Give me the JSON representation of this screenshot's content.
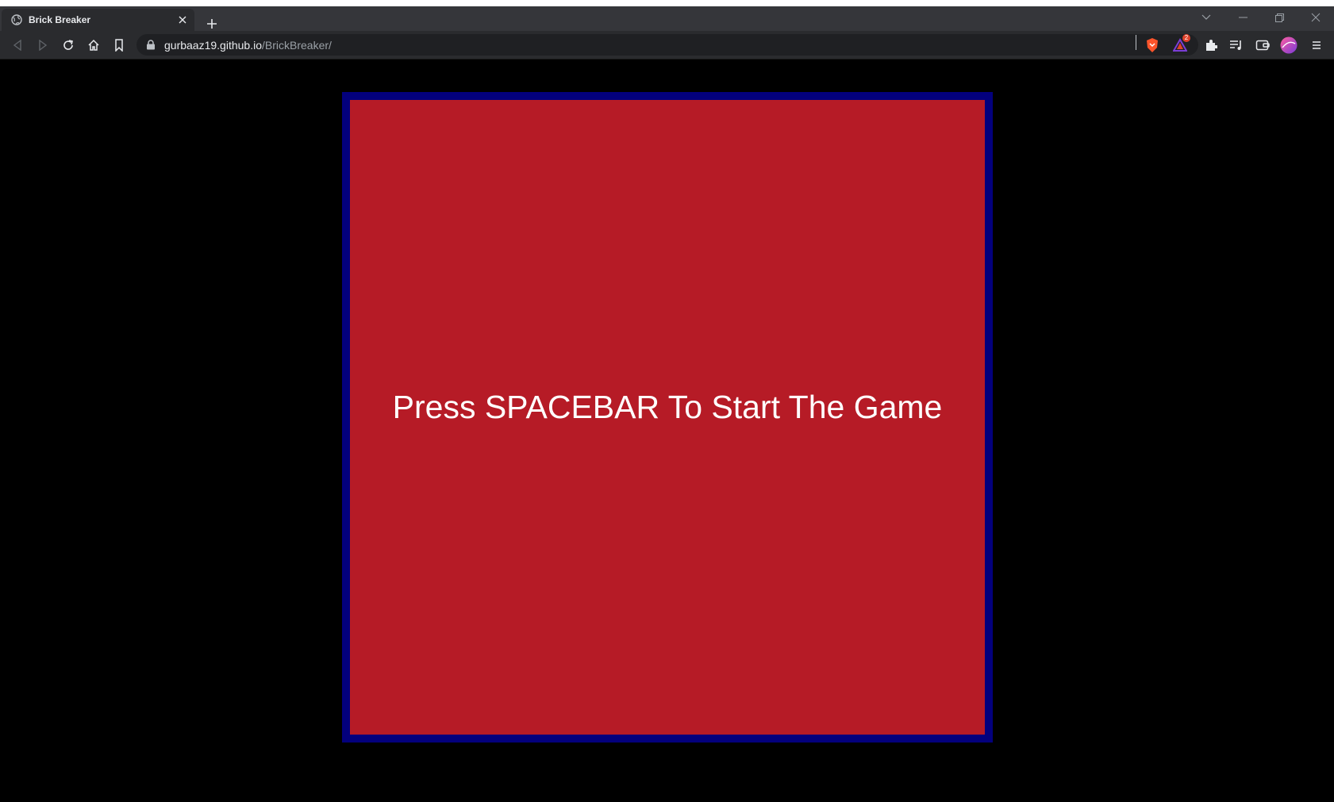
{
  "browser": {
    "tab": {
      "title": "Brick Breaker",
      "favicon": "globe-icon"
    },
    "new_tab_icon": "plus-icon",
    "window_controls": [
      "chevron-down-icon",
      "minimize-icon",
      "restore-icon",
      "close-icon"
    ],
    "toolbar": {
      "back_icon": "back-arrow-icon",
      "forward_icon": "forward-arrow-icon",
      "reload_icon": "reload-icon",
      "home_icon": "home-icon",
      "bookmark_icon": "bookmark-icon"
    },
    "address_bar": {
      "host": "gurbaaz19.github.io",
      "path": "/BrickBreaker/"
    },
    "extensions": {
      "brave_shield_icon": "brave-shield-icon",
      "rewards_icon": "brave-rewards-icon",
      "rewards_badge": "2",
      "extensions_icon": "puzzle-icon",
      "playlist_icon": "playlist-icon",
      "wallet_icon": "wallet-icon",
      "profile_icon": "profile-avatar",
      "menu_icon": "menu-icon"
    }
  },
  "game": {
    "message": "Press SPACEBAR To Start The Game",
    "colors": {
      "background": "#000000",
      "border": "#03007d",
      "canvas": "#b61b26",
      "text": "#ffffff"
    }
  }
}
